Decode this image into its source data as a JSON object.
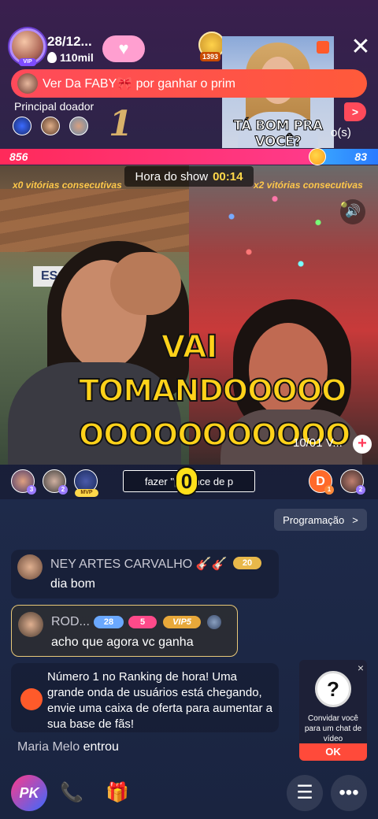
{
  "header": {
    "host_name": "28/12...",
    "host_likes": "110mil",
    "vip_label": "VIP",
    "rank_count": "1393",
    "close_label": "✕"
  },
  "ticker": {
    "text": "Ver Da FABY🎀 por ganhar o prim"
  },
  "donors": {
    "label": "Principal doador",
    "rank_number": "1"
  },
  "side": {
    "button_label": ">",
    "text": "o(s)"
  },
  "overlay_video": {
    "caption": "TÁ BOM PRA VOCÊ?"
  },
  "pk": {
    "score_left": "856",
    "score_right": "83"
  },
  "show": {
    "label": "Hora do show",
    "timer": "00:14"
  },
  "wins": {
    "left": "x0 vitórias consecutivas",
    "right": "x2 vitórias consecutivas"
  },
  "captions": {
    "line1": "VAI",
    "line2": "TOMANDOOOOO",
    "line3": "OOOOOOOOOOO"
  },
  "date_text": "10/01 V...",
  "contributors": {
    "left_badges": [
      "3",
      "2"
    ],
    "mvp_label": "MVP",
    "right_initial": "D",
    "right_badges": [
      "1",
      "2"
    ]
  },
  "task": {
    "text": "fazer \"pe      ance de p",
    "counter": "0"
  },
  "programacao": {
    "label": "Programação",
    "chevron": ">"
  },
  "chat": [
    {
      "name": "NEY ARTES CARVALHO 🎸🎸",
      "level": "20",
      "text": "dia bom"
    },
    {
      "name": "ROD...",
      "badge1": "28",
      "badge2": "5",
      "badge3": "VIP5",
      "text": "acho que agora vc ganha"
    }
  ],
  "notice": {
    "text": "Número 1 no Ranking de hora! Uma grande onda de usuários está chegando, envie uma caixa de oferta para aumentar a sua base de fãs!"
  },
  "entered": {
    "user": "Maria Melo",
    "action": " entrou"
  },
  "invite": {
    "close": "×",
    "question": "?",
    "text": "Convidar você para um chat de vídeo",
    "ok": "OK"
  },
  "bottom": {
    "pk_label": "PK",
    "phone_icon": "📞",
    "gift_icon": "🎁",
    "menu_icon": "☰",
    "more_icon": "•••"
  }
}
